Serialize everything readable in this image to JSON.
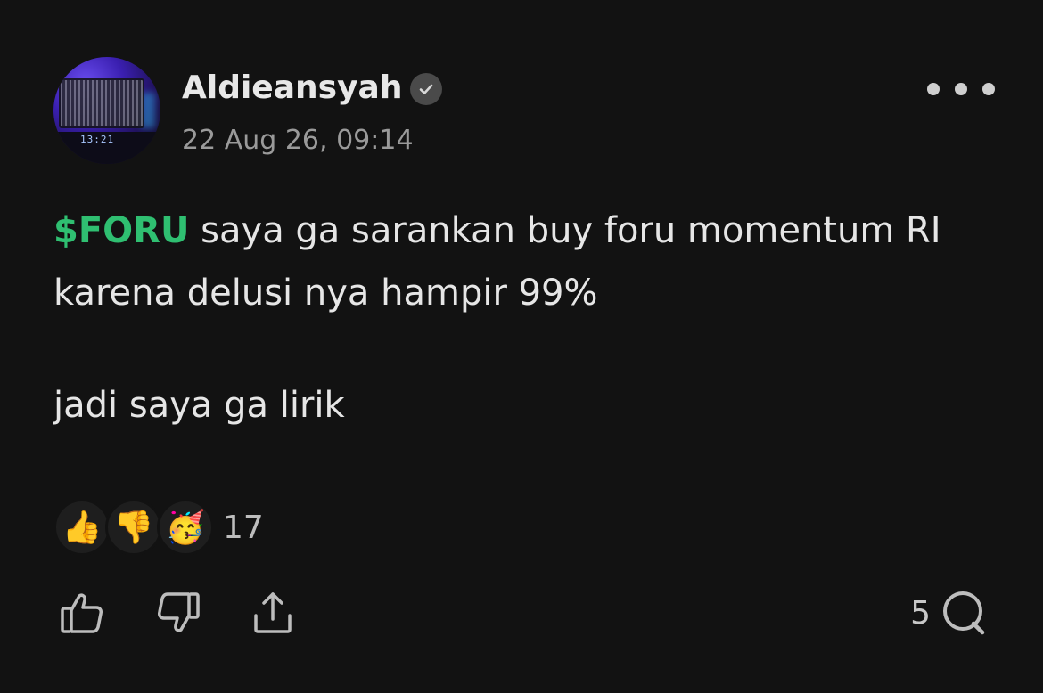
{
  "post": {
    "author": "Aldieansyah",
    "verified_icon": "check-badge-icon",
    "timestamp": "22 Aug 26, 09:14",
    "more_icon": "more-dots-icon",
    "avatar": {
      "clock_text": "13:21"
    },
    "ticker": "$FORU",
    "text_line1_rest": " saya ga sarankan buy foru momentum RI",
    "text_line2": "karena delusi nya hampir 99%",
    "text_line3": "jadi saya ga lirik",
    "reactions": {
      "emojis": [
        "👍",
        "👎",
        "🥳"
      ],
      "count": "17"
    },
    "actions": {
      "like_icon": "thumbs-up-icon",
      "dislike_icon": "thumbs-down-icon",
      "share_icon": "share-icon",
      "comment_icon": "comment-icon",
      "comment_count": "5"
    }
  },
  "colors": {
    "background": "#121212",
    "ticker": "#2fbf71",
    "text": "#e6e6e6",
    "muted": "#9a9a9a"
  }
}
